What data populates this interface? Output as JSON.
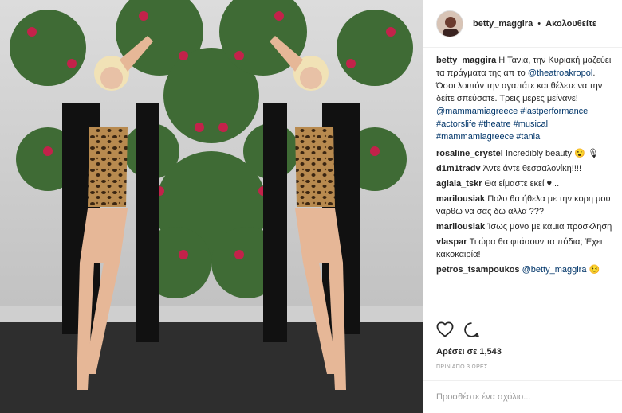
{
  "header": {
    "username": "betty_maggira",
    "separator": "•",
    "follow_label": "Ακολουθείτε"
  },
  "caption": {
    "username": "betty_maggira",
    "text_1": "Η Τανια, την Κυριακή μαζεύει τα πράγματα της απ το",
    "mention_1": "@theatroakropol",
    "text_2": ". Όσοι λοιπόν την αγαπάτε και θέλετε να την δείτε σπεύσατε. Τρεις μερες μείνανε!",
    "mention_2": "@mammamiagreece",
    "tag_1": "#lastperformance",
    "tag_2": "#actorslife",
    "tag_3": "#theatre",
    "tag_4": "#musical",
    "tag_5": "#mammamiagreece",
    "tag_6": "#tania"
  },
  "comments": [
    {
      "username": "rosaline_crystel",
      "text": "Incredibly beauty 😮 🎙"
    },
    {
      "username": "d1m1tradv",
      "text": "Άντε άντε θεσσαλονίκη!!!!"
    },
    {
      "username": "aglaia_tskr",
      "text": "Θα είμαστε εκεί ♥..."
    },
    {
      "username": "marilousiak",
      "text": "Πολυ θα ήθελα με την κορη μου ναρθω να σας δω αλλα ???"
    },
    {
      "username": "marilousiak",
      "text": "Ίσως μονο με καμια προσκληση"
    },
    {
      "username": "vlaspar",
      "text": "Τι ώρα θα φτάσουν τα πόδια; Έχει κακοκαιρία!"
    },
    {
      "username": "petros_tsampoukos",
      "mention": "@betty_maggira",
      "text": "😉"
    }
  ],
  "likes_label": "Αρέσει σε 1,543",
  "time_label": "ΠΡΙΝ ΑΠΟ 3 ΩΡΕΣ",
  "add_comment_placeholder": "Προσθέστε ένα σχόλιο...",
  "icons": {
    "like": "heart-icon",
    "comment": "comment-bubble-icon"
  },
  "colors": {
    "link": "#003569",
    "text": "#262626",
    "muted": "#999999"
  }
}
